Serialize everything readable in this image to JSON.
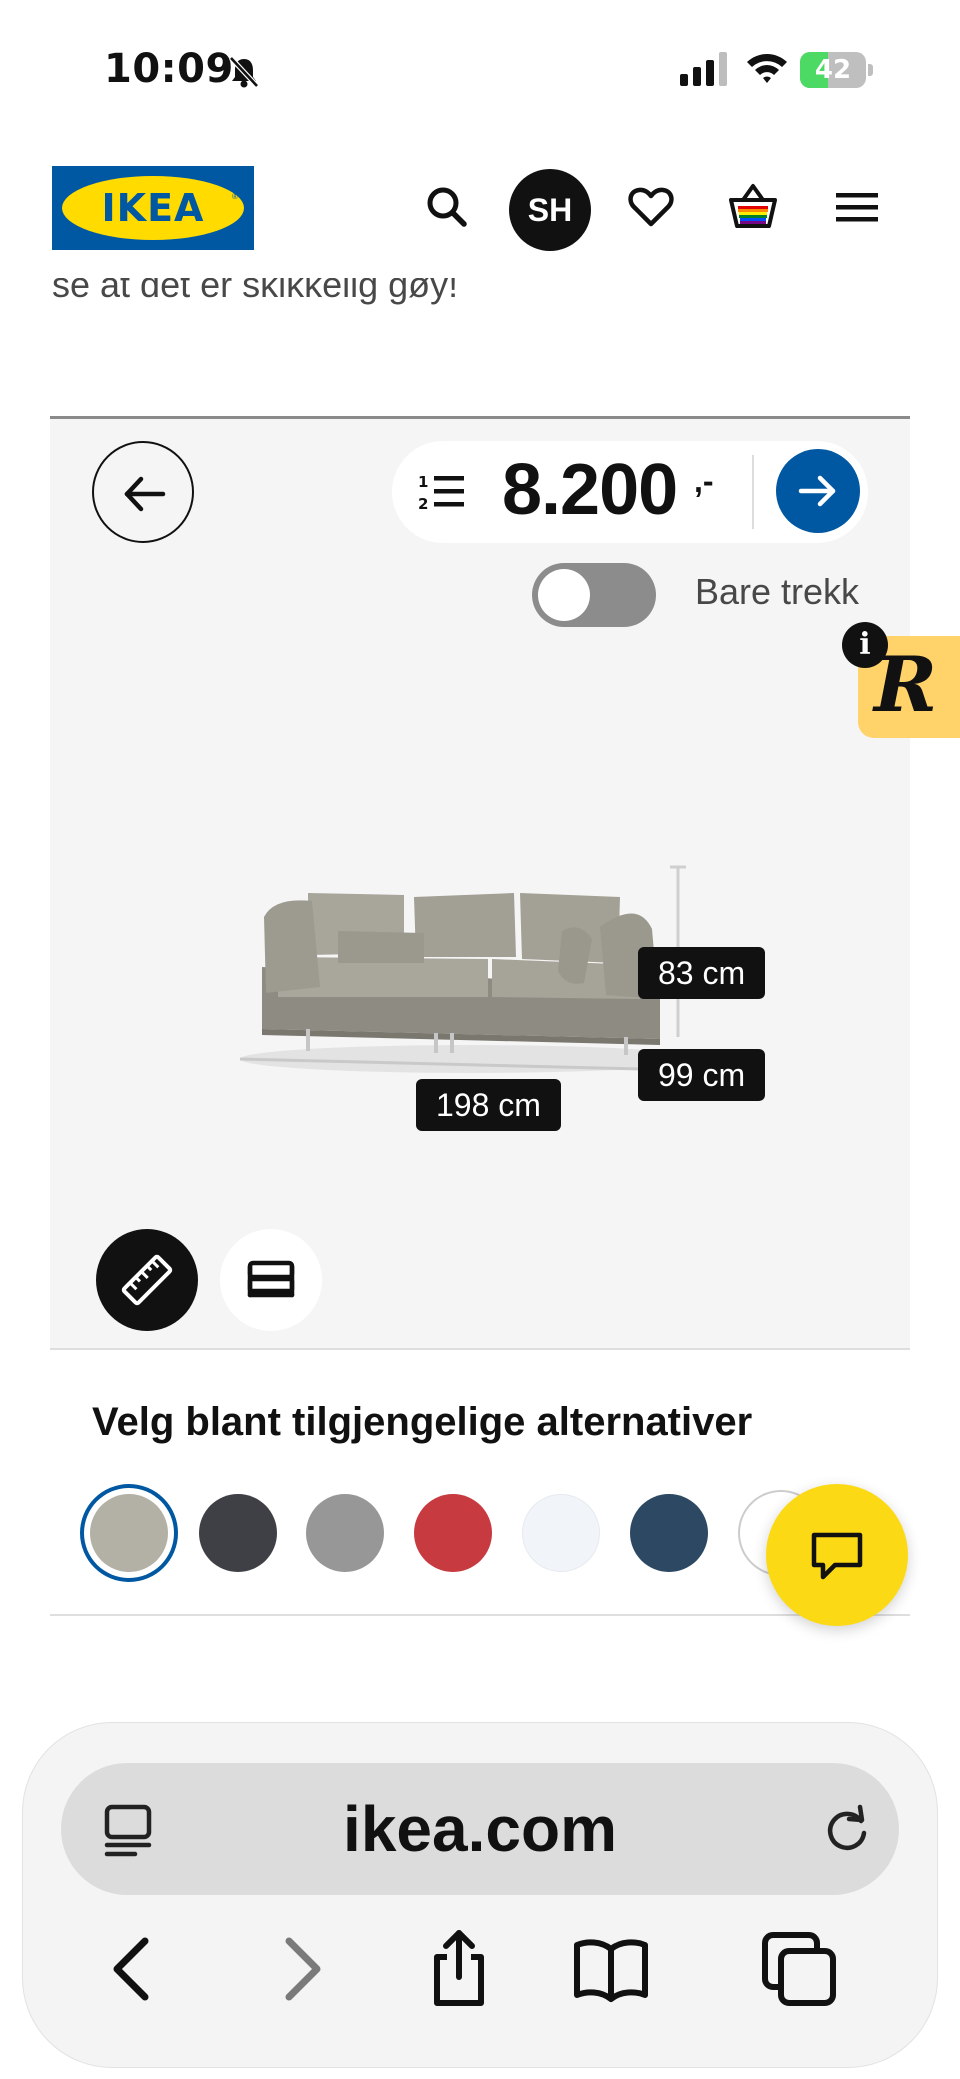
{
  "status_bar": {
    "time": "10:09",
    "battery": "42",
    "battery_level": 0.42,
    "battery_color": "#4cd964"
  },
  "header": {
    "logo_text": "IKEA",
    "logo_colors": {
      "blue": "#0058a3",
      "yellow": "#ffdb00"
    },
    "avatar_initials": "SH",
    "icons": [
      "search-icon",
      "heart-icon",
      "basket-icon",
      "menu-icon"
    ]
  },
  "partial_text": "se at det er skikkelig gøy!",
  "configurator": {
    "price": "8.200",
    "price_suffix": ",-",
    "toggle_label": "Bare trekk",
    "toggle_on": false,
    "dimensions": {
      "height": "83 cm",
      "depth": "99 cm",
      "width": "198 cm"
    },
    "accent_color": "#0058a3"
  },
  "alternatives": {
    "heading": "Velg blant tilgjengelige alternativer",
    "swatches": [
      {
        "name": "beige-grey",
        "color": "#b3b0a6",
        "selected": true
      },
      {
        "name": "dark-grey",
        "color": "#3f4045",
        "selected": false
      },
      {
        "name": "grey",
        "color": "#979797",
        "selected": false
      },
      {
        "name": "red",
        "color": "#c73a40",
        "selected": false
      },
      {
        "name": "white",
        "color": "#f1f4f8",
        "selected": false
      },
      {
        "name": "dark-blue",
        "color": "#2c4862",
        "selected": false
      }
    ],
    "more_label": "+"
  },
  "browser": {
    "url": "ikea.com"
  }
}
